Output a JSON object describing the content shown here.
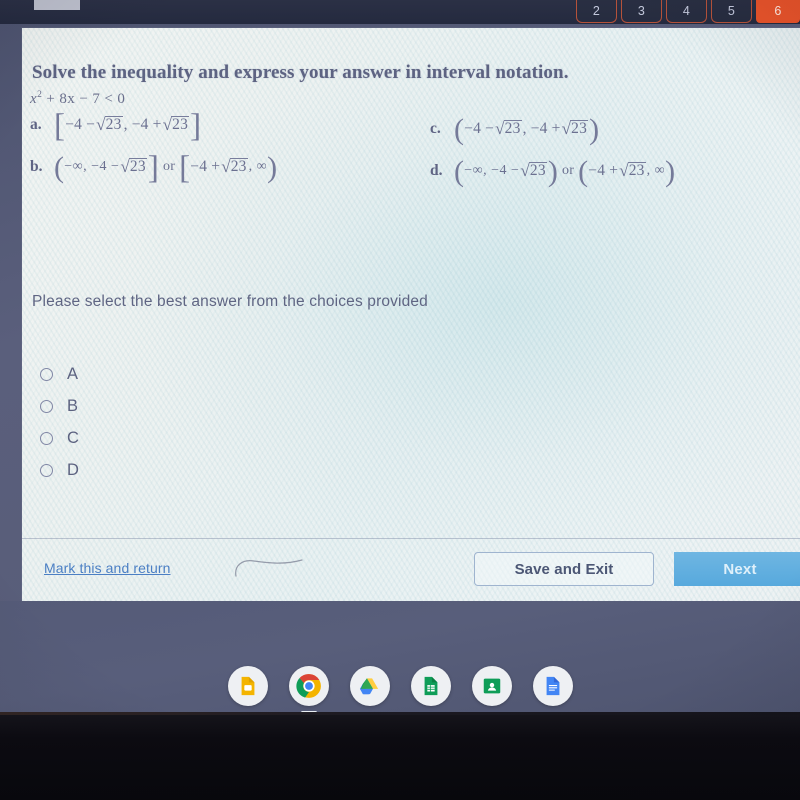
{
  "browser": {
    "tab_stub": "",
    "number_tabs": [
      {
        "label": "2",
        "active": false
      },
      {
        "label": "3",
        "active": false
      },
      {
        "label": "4",
        "active": false
      },
      {
        "label": "5",
        "active": false
      },
      {
        "label": "6",
        "active": true
      }
    ]
  },
  "quiz": {
    "prompt": "Solve the inequality and express your answer in interval notation.",
    "equation": {
      "base": "x",
      "exponent": "2",
      "rest": "+ 8x − 7 < 0"
    },
    "choices": [
      {
        "letter": "a.",
        "open": "[",
        "close": "]",
        "text": "[−4 − √23, −4 + √23]",
        "left_term": "−4 −",
        "radicand": "23",
        "mid": ", −4 +",
        "radicand2": "23"
      },
      {
        "letter": "b.",
        "open": "(",
        "close": "]",
        "open2": "[",
        "close2": ")",
        "text": "(−∞, −4 − √23] or [−4 + √23, ∞)",
        "first_left": "−∞, −4 −",
        "radicand": "23",
        "or_word": "or",
        "second_left": "−4 +",
        "radicand2": "23",
        "second_right": ", ∞"
      },
      {
        "letter": "c.",
        "open": "(",
        "close": ")",
        "text": "(−4 − √23, −4 + √23)",
        "left_term": "−4 −",
        "radicand": "23",
        "mid": ", −4 +",
        "radicand2": "23"
      },
      {
        "letter": "d.",
        "open": "(",
        "close": ")",
        "open2": "(",
        "close2": ")",
        "text": "(−∞, −4 − √23) or (−4 + √23, ∞)",
        "first_left": "−∞, −4 −",
        "radicand": "23",
        "or_word": "or",
        "second_left": "−4 +",
        "radicand2": "23",
        "second_right": ", ∞"
      }
    ],
    "select_instruction": "Please select the best answer from the choices provided",
    "radio_options": [
      {
        "label": "A",
        "selected": false
      },
      {
        "label": "B",
        "selected": false
      },
      {
        "label": "C",
        "selected": false
      },
      {
        "label": "D",
        "selected": false
      }
    ],
    "footer": {
      "mark_return_link": "Mark this and return",
      "save_exit_label": "Save and Exit",
      "next_label": "Next"
    }
  },
  "shelf": {
    "icons": [
      {
        "name": "google-slides-icon",
        "title": "Slides"
      },
      {
        "name": "google-chrome-icon",
        "title": "Chrome",
        "active": true
      },
      {
        "name": "google-drive-icon",
        "title": "Drive"
      },
      {
        "name": "google-sheets-icon",
        "title": "Sheets"
      },
      {
        "name": "google-classroom-icon",
        "title": "Classroom"
      },
      {
        "name": "google-docs-icon",
        "title": "Docs"
      }
    ]
  },
  "colors": {
    "tab_accent": "#e8532a",
    "next_button": "#57a9dd",
    "link": "#4b7fc4",
    "text": "#5f6583"
  }
}
